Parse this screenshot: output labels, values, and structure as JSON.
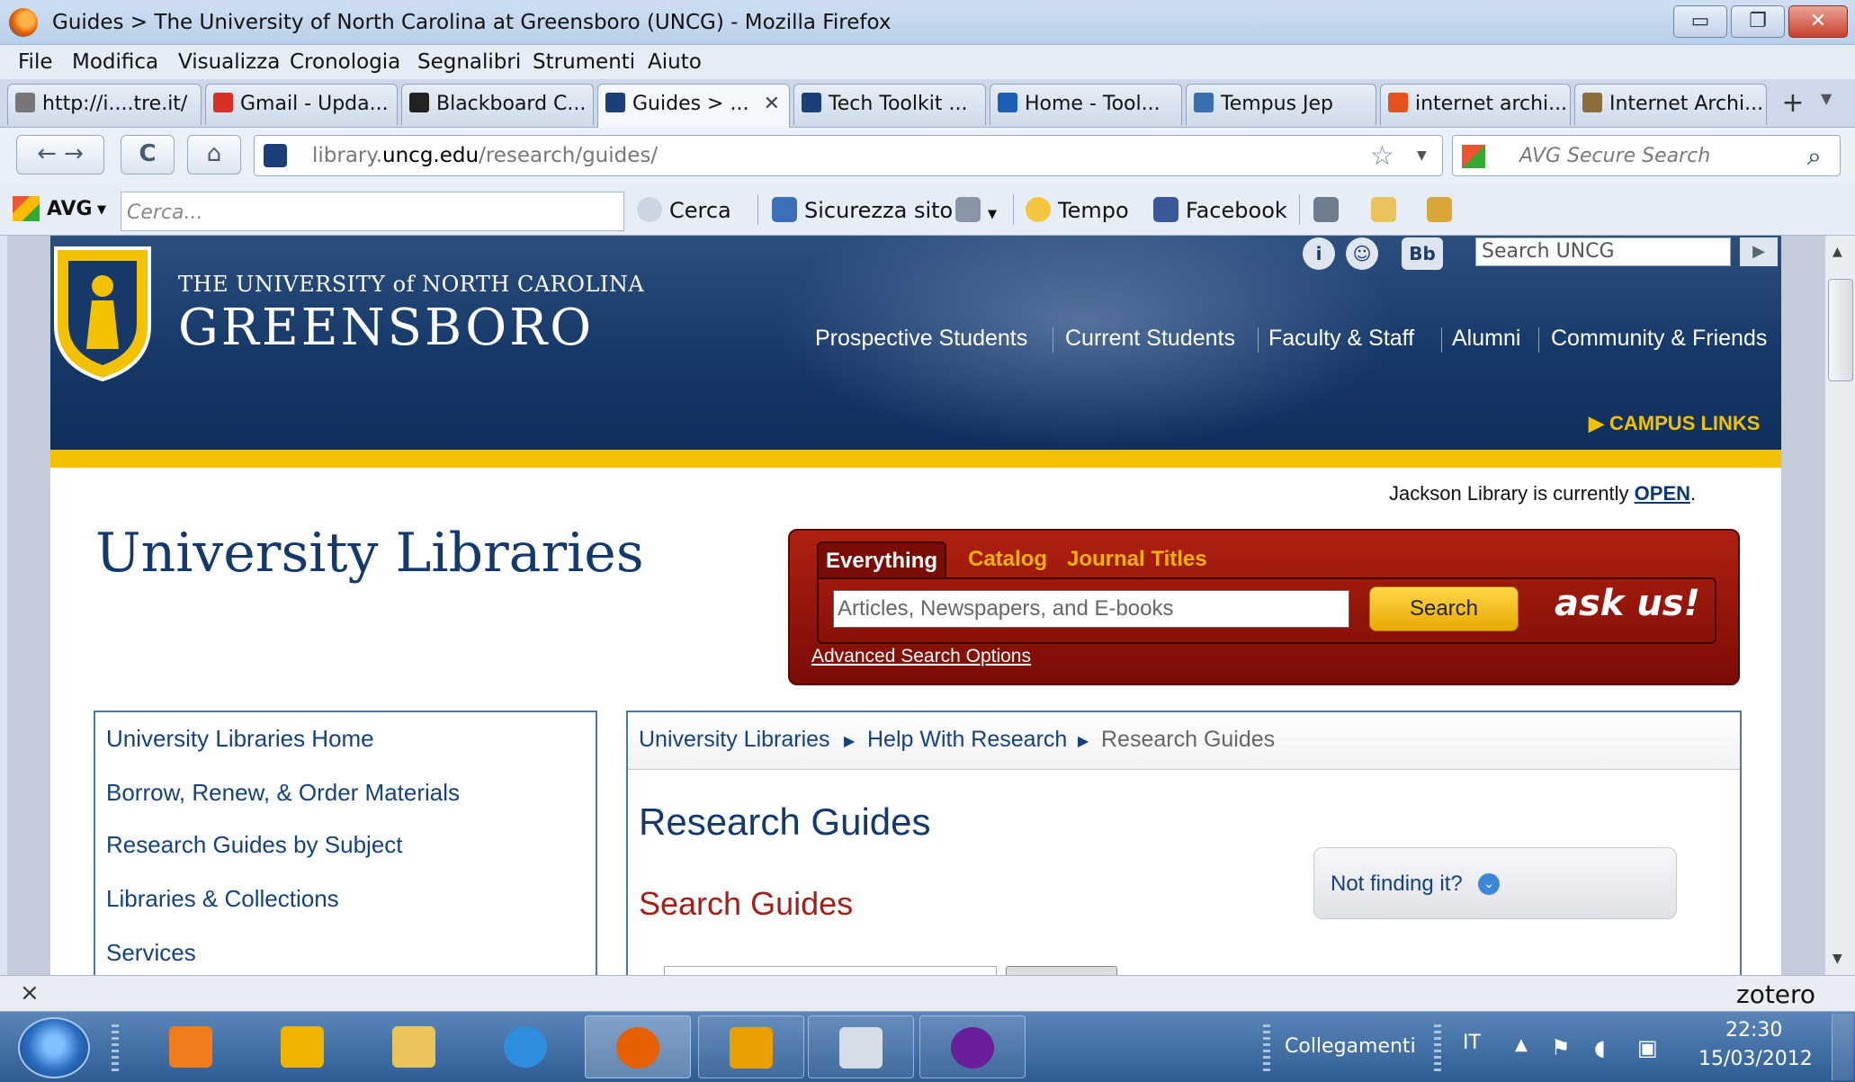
{
  "window": {
    "title": "Guides > The University of North Carolina at Greensboro (UNCG) - Mozilla Firefox",
    "min": "▭",
    "max": "❐",
    "close": "✕"
  },
  "menu": [
    "File",
    "Modifica",
    "Visualizza",
    "Cronologia",
    "Segnalibri",
    "Strumenti",
    "Aiuto"
  ],
  "tabs": [
    {
      "label": "http://i....tre.it/",
      "icon_color": "#777777"
    },
    {
      "label": "Gmail - Upda...",
      "icon_color": "#d93025"
    },
    {
      "label": "Blackboard C...",
      "icon_color": "#222222"
    },
    {
      "label": "Guides > ...",
      "icon_color": "#1b3f78",
      "active": true
    },
    {
      "label": "Tech Toolkit ...",
      "icon_color": "#1b3f78"
    },
    {
      "label": "Home - Tool...",
      "icon_color": "#1a5fb4"
    },
    {
      "label": "Tempus Jep",
      "icon_color": "#3a6fb0"
    },
    {
      "label": "internet archi...",
      "icon_color": "#e5531a"
    },
    {
      "label": "Internet Archi...",
      "icon_color": "#8a6d3b"
    }
  ],
  "tab_close": "✕",
  "tab_new": "+",
  "nav": {
    "back": "←",
    "forward": "→",
    "reload": "C",
    "home": "⌂",
    "url_prefix": "library.",
    "url_domain": "uncg.edu",
    "url_path": "/research/guides/",
    "bookmark_star": "☆",
    "search_placeholder": "AVG Secure Search",
    "search_icon": "⌕"
  },
  "avg_toolbar": {
    "brand": "AVG",
    "search_placeholder": "Cerca...",
    "cerca": "Cerca",
    "site_safety": "Sicurezza sito",
    "weather": "Tempo",
    "facebook": "Facebook"
  },
  "site": {
    "uni_line1": "THE UNIVERSITY of NORTH CAROLINA",
    "uni_line2": "GREENSBORO",
    "search_placeholder": "Search UNCG",
    "header_icons": [
      "i",
      "☺",
      "Bb"
    ],
    "nav": [
      "Prospective Students",
      "Current Students",
      "Faculty & Staff",
      "Alumni",
      "Community & Friends"
    ],
    "campus_links": "▶  CAMPUS LINKS",
    "status_prefix": "Jackson Library is currently ",
    "status_value": "OPEN",
    "status_suffix": ".",
    "lib_title": "University Libraries",
    "search_tabs": [
      "Everything",
      "Catalog",
      "Journal Titles"
    ],
    "search_input": "Articles, Newspapers, and E-books",
    "search_button": "Search",
    "ask_us": "ask us!",
    "advanced": "Advanced Search Options",
    "left_nav": [
      "University Libraries Home",
      "Borrow, Renew, & Order Materials",
      "Research Guides by Subject",
      "Libraries & Collections",
      "Services"
    ],
    "breadcrumb": [
      "University Libraries",
      "Help With Research",
      "Research Guides"
    ],
    "page_title": "Research Guides",
    "section_title": "Search Guides",
    "not_finding": "Not finding it?",
    "not_finding_icon": "⌄"
  },
  "addon_bar": {
    "close": "×",
    "zotero": "zotero"
  },
  "taskbar": {
    "apps": [
      {
        "name": "media-player",
        "color": "#f07d1a"
      },
      {
        "name": "paint",
        "color": "#f0b400"
      },
      {
        "name": "file-explorer",
        "color": "#e8c45a"
      },
      {
        "name": "internet-explorer",
        "color": "#2f8ee0"
      },
      {
        "name": "firefox",
        "color": "#e66000",
        "active": true
      },
      {
        "name": "winamp",
        "color": "#e8a000"
      },
      {
        "name": "odf-viewer",
        "color": "#d6dde6"
      },
      {
        "name": "arrow-app",
        "color": "#6a1f9a"
      }
    ],
    "links_label": "Collegamenti",
    "language": "IT",
    "tray_arrow": "▲",
    "time": "22:30",
    "date": "15/03/2012"
  },
  "colors": {
    "uncg_navy": "#173969",
    "uncg_gold": "#f2c200",
    "search_red": "#a0180c"
  }
}
